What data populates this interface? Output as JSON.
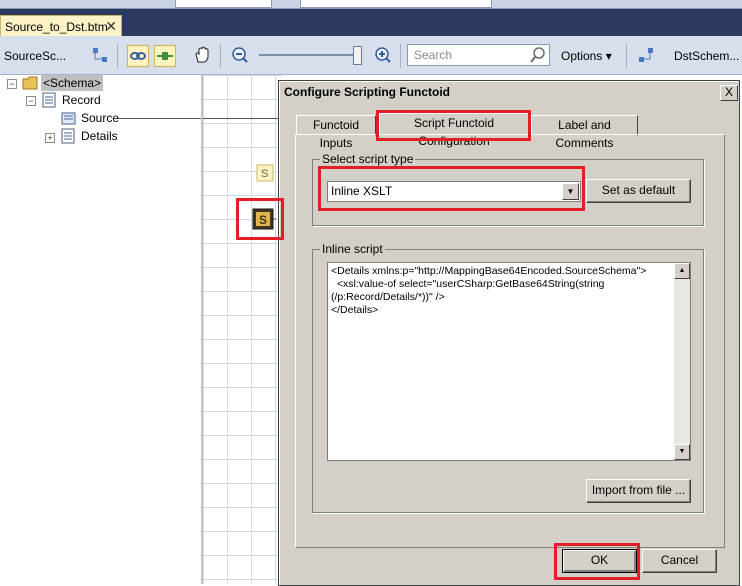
{
  "document_tab": {
    "title": "Source_to_Dst.btm",
    "close_glyph": "✕"
  },
  "toolbar": {
    "source_schema_label": "SourceSc...",
    "search_placeholder": "Search",
    "options_label": "Options",
    "dest_schema_label": "DstSchem..."
  },
  "tree": {
    "schema_label": "<Schema>",
    "record_label": "Record",
    "source_label": "Source",
    "details_label": "Details"
  },
  "dialog": {
    "title": "Configure Scripting Functoid",
    "close_glyph": "X",
    "tabs": [
      "Functoid Inputs",
      "Script Functoid Configuration",
      "Label and Comments"
    ],
    "active_tab_index": 1,
    "script_type_group": "Select script type",
    "script_type_value": "Inline XSLT",
    "set_default_button": "Set as default",
    "inline_script_group": "Inline script",
    "inline_script": "<Details xmlns:p=\"http://MappingBase64Encoded.SourceSchema\">\n  <xsl:value-of select=\"userCSharp:GetBase64String(string\n(/p:Record/Details/*))\" />\n</Details>",
    "import_button": "Import from file ...",
    "ok_button": "OK",
    "cancel_button": "Cancel"
  },
  "highlight_color": "#e21f26"
}
